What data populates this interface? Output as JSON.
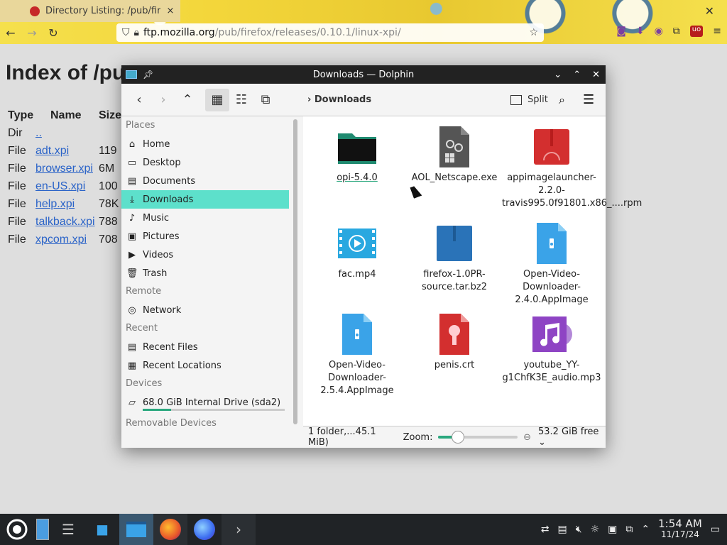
{
  "browser": {
    "tab_title": "Directory Listing: /pub/fir",
    "tab_close": "×",
    "window_close": "✕",
    "url_host": "ftp.mozilla.org",
    "url_path": "/pub/firefox/releases/0.10.1/linux-xpi/",
    "ublock_label": "uo"
  },
  "listing": {
    "heading": "Index of /pu",
    "headers": [
      "Type",
      "Name",
      "Size"
    ],
    "rows": [
      {
        "type": "Dir",
        "name": "..",
        "size": ""
      },
      {
        "type": "File",
        "name": "adt.xpi",
        "size": "119"
      },
      {
        "type": "File",
        "name": "browser.xpi",
        "size": "6M"
      },
      {
        "type": "File",
        "name": "en-US.xpi",
        "size": "100"
      },
      {
        "type": "File",
        "name": "help.xpi",
        "size": "78K"
      },
      {
        "type": "File",
        "name": "talkback.xpi",
        "size": "788"
      },
      {
        "type": "File",
        "name": "xpcom.xpi",
        "size": "708"
      }
    ]
  },
  "dolphin": {
    "title": "Downloads — Dolphin",
    "breadcrumb": "Downloads",
    "split_label": "Split",
    "places": {
      "sections": {
        "places": "Places",
        "remote": "Remote",
        "recent": "Recent",
        "devices": "Devices",
        "removable": "Removable Devices"
      },
      "items": [
        {
          "label": "Home",
          "icon": "home-icon"
        },
        {
          "label": "Desktop",
          "icon": "desktop-icon"
        },
        {
          "label": "Documents",
          "icon": "documents-icon"
        },
        {
          "label": "Downloads",
          "icon": "downloads-icon"
        },
        {
          "label": "Music",
          "icon": "music-icon"
        },
        {
          "label": "Pictures",
          "icon": "pictures-icon"
        },
        {
          "label": "Videos",
          "icon": "videos-icon"
        },
        {
          "label": "Trash",
          "icon": "trash-icon"
        }
      ],
      "remote_items": [
        {
          "label": "Network",
          "icon": "network-icon"
        }
      ],
      "recent_items": [
        {
          "label": "Recent Files",
          "icon": "recent-files-icon"
        },
        {
          "label": "Recent Locations",
          "icon": "recent-locations-icon"
        }
      ],
      "device_items": [
        {
          "label": "68.0 GiB Internal Drive (sda2)",
          "icon": "drive-icon",
          "used_fraction": 0.2
        }
      ]
    },
    "files": [
      {
        "name": "opi-5.4.0",
        "kind": "folder",
        "color": "#1f8a70"
      },
      {
        "name": "AOL_Netscape.exe",
        "kind": "exe",
        "color": "#555555"
      },
      {
        "name": "appimagelauncher-2.2.0-travis995.0f91801.x86_....rpm",
        "kind": "rpm",
        "color": "#d32f2f"
      },
      {
        "name": "fac.mp4",
        "kind": "video",
        "color": "#29a8e0"
      },
      {
        "name": "firefox-1.0PR-source.tar.bz2",
        "kind": "archive",
        "color": "#2a73b8"
      },
      {
        "name": "Open-Video-Downloader-2.4.0.AppImage",
        "kind": "appimage",
        "color": "#3aa3e8"
      },
      {
        "name": "Open-Video-Downloader-2.5.4.AppImage",
        "kind": "appimage",
        "color": "#3aa3e8"
      },
      {
        "name": "penis.crt",
        "kind": "cert",
        "color": "#d32f2f"
      },
      {
        "name": "youtube_YY-g1ChfK3E_audio.mp3",
        "kind": "audio",
        "color": "#8e44c4"
      }
    ],
    "status": {
      "info": "1 folder,...45.1 MiB)",
      "zoom_label": "Zoom:",
      "zoom_fraction": 0.25,
      "free": "53.2 GiB free"
    }
  },
  "taskbar": {
    "time": "1:54 AM",
    "date": "11/17/24"
  }
}
